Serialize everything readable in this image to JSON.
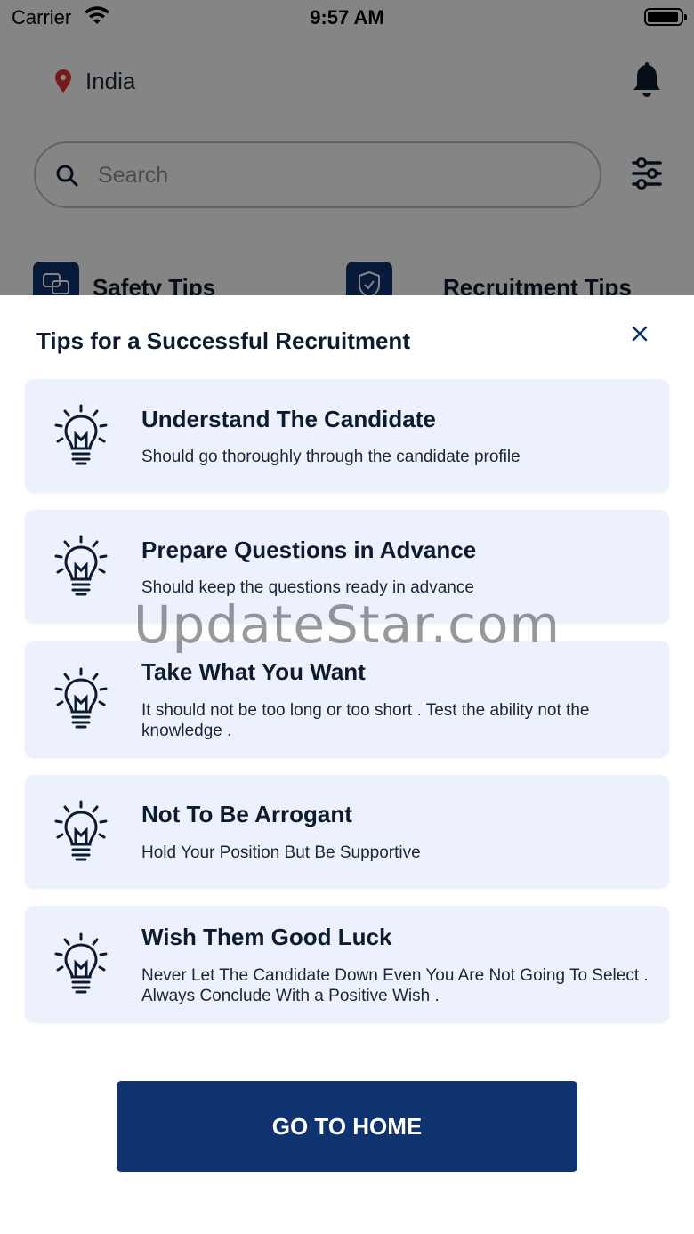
{
  "status_bar": {
    "carrier": "Carrier",
    "time": "9:57 AM"
  },
  "header": {
    "location": "India"
  },
  "search": {
    "placeholder": "Search"
  },
  "tabs": [
    {
      "label": "Safety Tips",
      "icon": "chat-bubbles-icon"
    },
    {
      "label": "Recruitment Tips",
      "icon": "shield-check-icon"
    }
  ],
  "sheet": {
    "title": "Tips for a Successful Recruitment",
    "tips": [
      {
        "title": "Understand The Candidate",
        "text": "Should go thoroughly through the candidate profile"
      },
      {
        "title": "Prepare Questions in Advance",
        "text": "Should keep the questions ready in advance"
      },
      {
        "title": "Take What You Want",
        "text": "It should not be too long or too short . Test the ability not the knowledge ."
      },
      {
        "title": "Not To Be Arrogant",
        "text": "Hold Your Position But Be Supportive"
      },
      {
        "title": "Wish Them Good Luck",
        "text": "Never Let The Candidate Down Even You Are Not Going To Select . Always Conclude With a Positive Wish ."
      }
    ],
    "button_label": "GO TO HOME"
  },
  "watermark": "UpdateStar.com",
  "colors": {
    "primary": "#0f336e",
    "card_bg": "#edf1fd",
    "pin": "#e0332e"
  }
}
